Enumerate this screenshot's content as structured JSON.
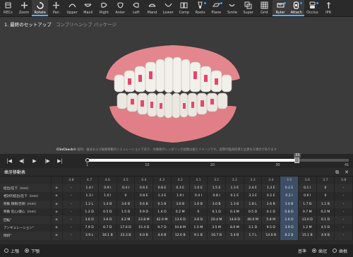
{
  "toolbar": {
    "items": [
      {
        "label": "RECs",
        "icon": "recs-icon",
        "active": false
      },
      {
        "label": "Zoom",
        "icon": "plus-icon",
        "active": false
      },
      {
        "label": "Rotate",
        "icon": "rotate-icon",
        "active": true
      },
      {
        "label": "Pan",
        "icon": "pan-icon",
        "active": false
      },
      {
        "label": "Upper",
        "icon": "upper-arch-icon",
        "active": false
      },
      {
        "label": "Maxil",
        "icon": "maxillary-icon",
        "active": false
      },
      {
        "label": "Right",
        "icon": "right-view-icon",
        "active": false
      },
      {
        "label": "Anter",
        "icon": "anterior-view-icon",
        "active": false
      },
      {
        "label": "Left",
        "icon": "left-view-icon",
        "active": false
      },
      {
        "label": "Mand",
        "icon": "mandibular-icon",
        "active": false
      },
      {
        "label": "Lower",
        "icon": "lower-arch-icon",
        "active": false
      },
      {
        "label": "Comp",
        "icon": "compare-icon",
        "active": false
      },
      {
        "label": "Roots",
        "icon": "roots-icon",
        "active": false
      },
      {
        "label": "Plane",
        "icon": "plane-icon",
        "active": false
      },
      {
        "label": "Smile",
        "icon": "smile-icon",
        "active": false
      },
      {
        "label": "Super",
        "icon": "superimpose-icon",
        "active": false
      },
      {
        "label": "Grid",
        "icon": "grid-icon",
        "active": false
      },
      {
        "label": "Ruler",
        "icon": "ruler-icon",
        "active": true
      },
      {
        "label": "Attach",
        "icon": "attach-icon",
        "active": true
      },
      {
        "label": "Occlus",
        "icon": "occlusion-icon",
        "active": false
      },
      {
        "label": "IPR",
        "icon": "ipr-icon",
        "active": false
      }
    ]
  },
  "header": {
    "title": "1. 最終のセットアップ",
    "subtitle": "コンプリヘンシブ パッケージ"
  },
  "disclaimer": {
    "brand": "ClinCheck®",
    "text": " 歯列、歯牙および歯根移動のシミュレーションであり、治療後のレンダリング画像は歯とイメージです。実際の臨床結果とは異なる場合があります"
  },
  "playback": {
    "current_stage": "33",
    "total_stage": 41,
    "ticks": [
      "1",
      "10",
      "20",
      "30",
      "41"
    ]
  },
  "panel": {
    "title": "歯牙移動表",
    "columns": [
      "4.8",
      "4.7",
      "4.6",
      "4.5",
      "4.4",
      "4.3",
      "4.2",
      "4.1",
      "3.1",
      "3.2",
      "3.3",
      "3.4",
      "3.5",
      "3.6",
      "3.7",
      "3.8"
    ],
    "selected_column": "3.5",
    "rows": [
      {
        "label": "挺出/圧下（mm）",
        "icon": "extrusion-icon",
        "values": [
          "-",
          "1.4 I",
          "0.9 I",
          "0.4 I",
          "0.6 E",
          "0.8 E",
          "0.3 E",
          "1.0 E",
          "1.5 E",
          "1.3 E",
          "2.4 E",
          "1.3 E",
          "0.2 E",
          "0.1 I",
          "0",
          "-"
        ]
      },
      {
        "label": "相対的挺出/圧下（mm）",
        "icon": "relative-extrusion-icon",
        "values": [
          "-",
          "1.3 I",
          "1.0 I",
          "0",
          "0.8 E",
          "1.3 E",
          "1.9 I",
          "0.4 I",
          "0.8 I",
          "0.1 E",
          "3.3 E",
          "0.2 E",
          "0.2 I",
          "0.6 I",
          "0",
          "-"
        ]
      },
      {
        "label": "移動 頬側/舌側（mm）",
        "icon": "buccal-lingual-icon",
        "values": [
          "-",
          "1.2 L",
          "1.4 B",
          "3.6 B",
          "0.6 B",
          "0.1 B",
          "3.6 B",
          "1.6 B",
          "3.0 B",
          "1.3 B",
          "1.8 L",
          "2.6 B",
          "3.0 B",
          "1.7 B",
          "1.1 B",
          "-"
        ]
      },
      {
        "label": "移動 近心/遠心（mm）",
        "icon": "mesial-distal-icon",
        "values": [
          "-",
          "1.2 D",
          "0.5 D",
          "1.5 D",
          "0.9 D",
          "1.4 D",
          "0.2 M",
          "0",
          "0.1 D",
          "0.3 M",
          "0.5 D",
          "0.1 D",
          "0.8 D",
          "0.7 M",
          "0.2 M",
          "-"
        ]
      },
      {
        "label": "回転°",
        "icon": "rotation-icon",
        "values": [
          "-",
          "3.6 D",
          "3.6 D",
          "4.2 M",
          "23.8 M",
          "42.0 M",
          "13.6 D",
          "3.8 D",
          "20.4 M",
          "14.8 D",
          "40.0 M",
          "5.8 M",
          "2.6 D",
          "13.0 D",
          "0.1 D",
          "-"
        ]
      },
      {
        "label": "アンギュレーション°",
        "icon": "angulation-icon",
        "values": [
          "-",
          "7.9 D",
          "6.7 D",
          "17.0 D",
          "15.4 D",
          "9.7 D",
          "10.8 M",
          "1.5 M",
          "3.5 M",
          "8.0 M",
          "3.1 D",
          "9.5 D",
          "3.9 D",
          "1.2 M",
          "4.5 D",
          "-"
        ]
      },
      {
        "label": "傾斜°",
        "icon": "inclination-icon",
        "values": [
          "-",
          "3.9 L",
          "16.1 B",
          "23.3 B",
          "6.0 B",
          "4.6 B",
          "12.6 B",
          "9.1 B",
          "16.7 B",
          "5.4 B",
          "1.7 L",
          "14.0 B",
          "8.2 B",
          "15.1 B",
          "4.9 B",
          "-"
        ]
      }
    ]
  },
  "footer": {
    "arch_options": [
      {
        "label": "上顎",
        "selected": false
      },
      {
        "label": "下顎",
        "selected": true
      }
    ],
    "reference_label": "基準",
    "reference_options": [
      {
        "label": "歯冠",
        "selected": true
      },
      {
        "label": "歯根",
        "selected": false
      }
    ]
  },
  "colors": {
    "accent": "#2ea3ff",
    "attachment": "#e8456a",
    "gingiva": "#e8828a"
  }
}
